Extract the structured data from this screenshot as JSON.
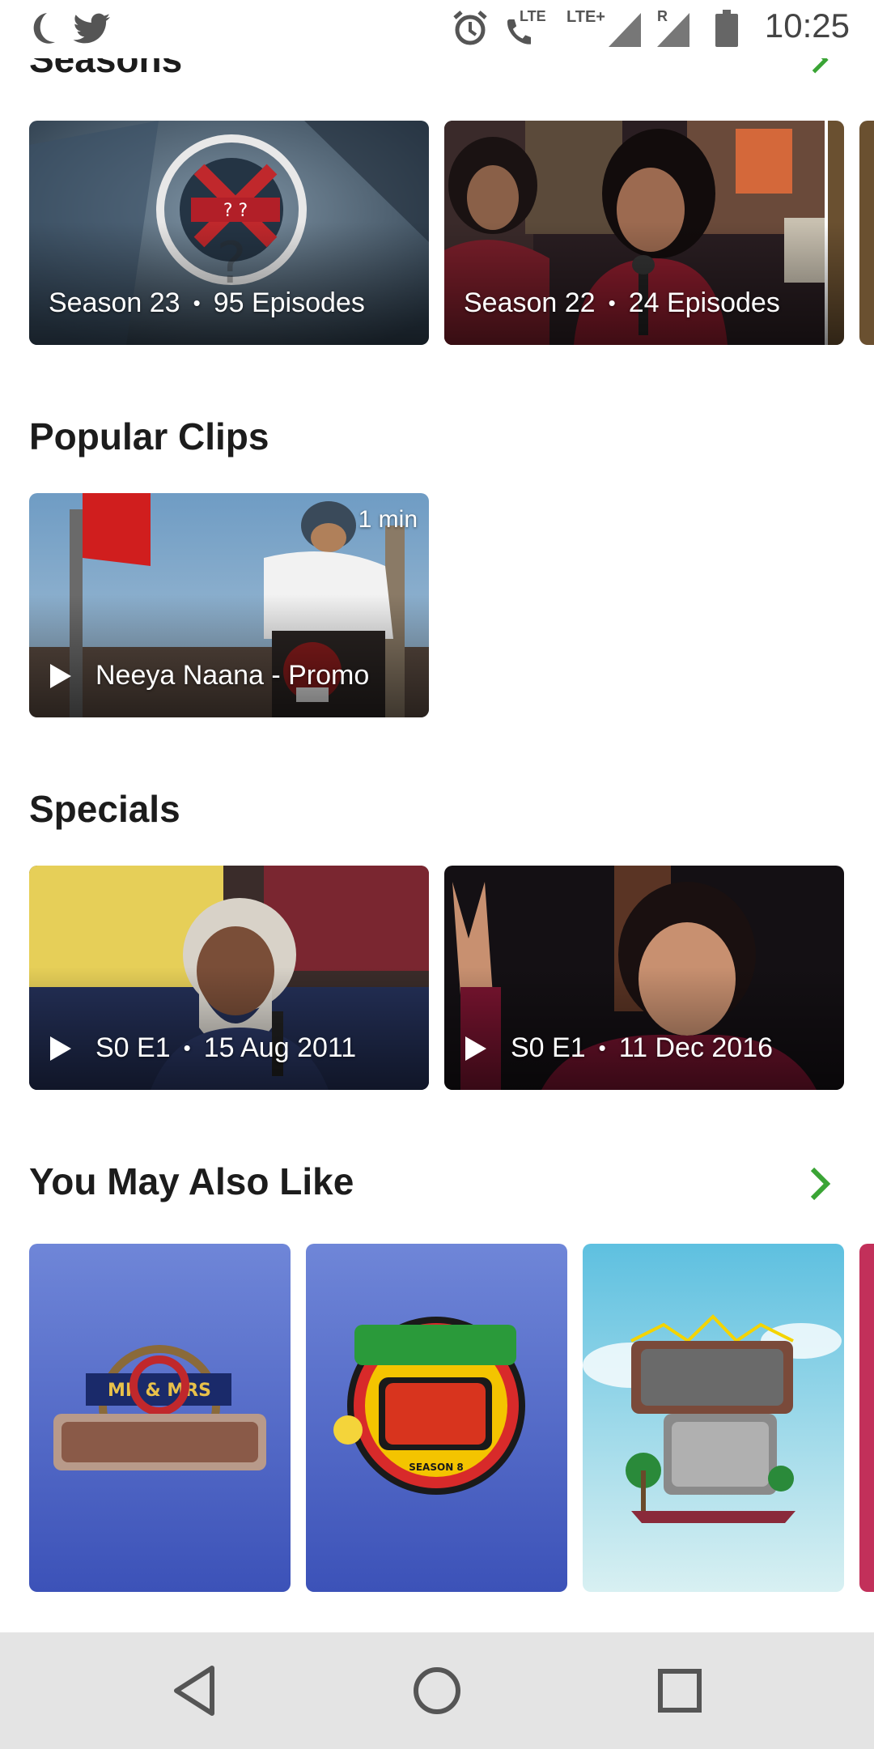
{
  "status_bar": {
    "time": "10:25",
    "icons": [
      "moon-icon",
      "twitter-icon",
      "alarm-icon",
      "volte-call-icon",
      "lte-plus-icon",
      "signal-icon",
      "roaming-signal-icon",
      "battery-icon"
    ],
    "lte_label": "LTE",
    "lte_plus_label": "LTE+",
    "roaming_label": "R"
  },
  "seasons": {
    "title": "Seasons",
    "accent": "#3aa435",
    "items": [
      {
        "season": "Season 23",
        "episodes": "95 Episodes",
        "dot": "•"
      },
      {
        "season": "Season 22",
        "episodes": "24 Episodes",
        "dot": "•"
      }
    ]
  },
  "popular_clips": {
    "title": "Popular Clips",
    "items": [
      {
        "title": "Neeya Naana - Promo",
        "duration": "1 min",
        "icon": "play-icon"
      }
    ]
  },
  "specials": {
    "title": "Specials",
    "items": [
      {
        "episode": "S0 E1",
        "date": "15 Aug 2011",
        "dot": "•",
        "icon": "play-icon"
      },
      {
        "episode": "S0 E1",
        "date": "11 Dec 2016",
        "dot": "•",
        "icon": "play-icon"
      }
    ]
  },
  "you_may_also_like": {
    "title": "You May Also Like",
    "accent": "#3aa435",
    "items": [
      {
        "poster_text": "MR & MRS"
      },
      {
        "poster_text": "SEASON 8"
      },
      {
        "poster_text": ""
      }
    ]
  },
  "nav_bar": {
    "icons": [
      "back-icon",
      "home-icon",
      "recents-icon"
    ]
  }
}
